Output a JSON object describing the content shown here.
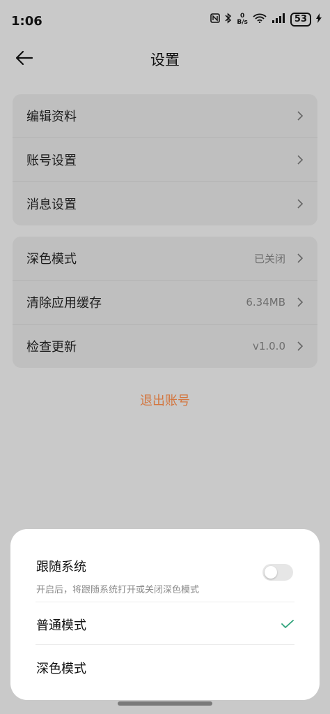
{
  "status_bar": {
    "time": "1:06",
    "net_speed_value": "0",
    "net_speed_unit": "B/s",
    "battery": "53"
  },
  "header": {
    "title": "设置"
  },
  "group1": [
    {
      "label": "编辑资料"
    },
    {
      "label": "账号设置"
    },
    {
      "label": "消息设置"
    }
  ],
  "group2": [
    {
      "label": "深色模式",
      "value": "已关闭"
    },
    {
      "label": "清除应用缓存",
      "value": "6.34MB"
    },
    {
      "label": "检查更新",
      "value": "v1.0.0"
    }
  ],
  "logout_label": "退出账号",
  "dark_mode_sheet": {
    "follow_system": {
      "title": "跟随系统",
      "subtitle": "开启后，将跟随系统打开或关闭深色模式",
      "enabled": false
    },
    "options": [
      {
        "label": "普通模式",
        "selected": true
      },
      {
        "label": "深色模式",
        "selected": false
      }
    ]
  },
  "colors": {
    "accent_logout": "#d3763f",
    "check": "#2fa37a",
    "overlay_bg": "#c9c9c9"
  }
}
